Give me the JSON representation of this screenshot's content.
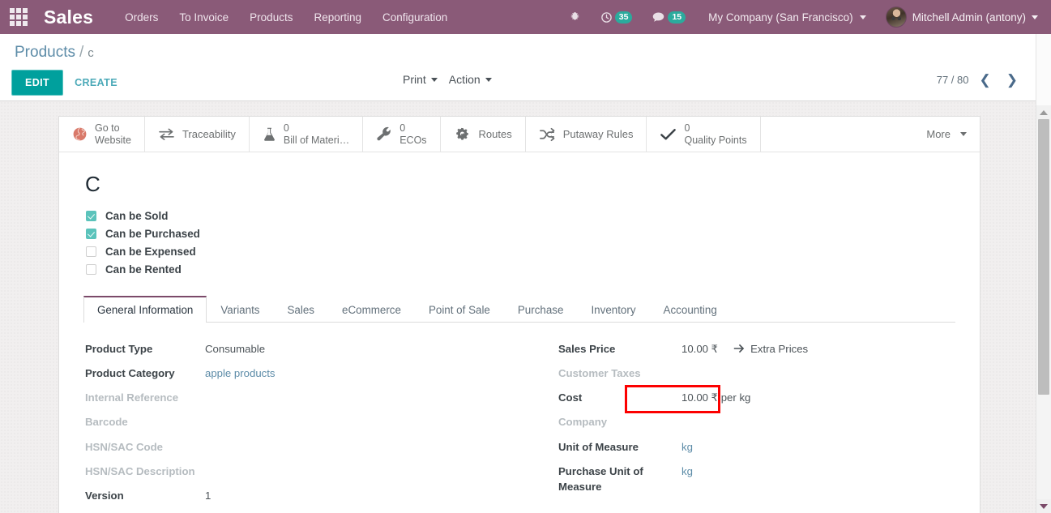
{
  "topbar": {
    "apps_icon": "apps-grid-icon",
    "brand": "Sales",
    "menu": [
      {
        "label": "Orders"
      },
      {
        "label": "To Invoice"
      },
      {
        "label": "Products"
      },
      {
        "label": "Reporting"
      },
      {
        "label": "Configuration"
      }
    ],
    "bug_icon": "bug-icon",
    "activities": {
      "icon": "clock-icon",
      "count": "35"
    },
    "messages": {
      "icon": "chat-bubble-icon",
      "count": "15"
    },
    "company": "My Company (San Francisco)",
    "user": "Mitchell Admin (antony)",
    "accent": "#8a5a78"
  },
  "control_panel": {
    "breadcrumb_root": "Products",
    "breadcrumb_separator": "/",
    "breadcrumb_current": "c",
    "edit_label": "EDIT",
    "create_label": "CREATE",
    "print_label": "Print",
    "action_label": "Action",
    "pager_text": "77 / 80",
    "prev_icon": "chevron-left-icon",
    "next_icon": "chevron-right-icon"
  },
  "button_box": [
    {
      "icon": "globe-icon",
      "value": "",
      "label": "Go to",
      "label2": "Website",
      "multiline": true
    },
    {
      "icon": "exchange-icon",
      "value": "",
      "label": "Traceability",
      "multiline": false
    },
    {
      "icon": "flask-icon",
      "value": "0",
      "label": "Bill of Materi…",
      "multiline": true
    },
    {
      "icon": "wrench-icon",
      "value": "0",
      "label": "ECOs",
      "multiline": true
    },
    {
      "icon": "cogs-icon",
      "value": "",
      "label": "Routes",
      "multiline": false
    },
    {
      "icon": "shuffle-icon",
      "value": "",
      "label": "Putaway Rules",
      "multiline": false
    },
    {
      "icon": "check-icon",
      "value": "0",
      "label": "Quality Points",
      "multiline": true
    },
    {
      "icon": "chevron-down-icon",
      "value": "",
      "label": "More",
      "multiline": false
    }
  ],
  "product": {
    "title": "C",
    "checkboxes": [
      {
        "label": "Can be Sold",
        "checked": true
      },
      {
        "label": "Can be Purchased",
        "checked": true
      },
      {
        "label": "Can be Expensed",
        "checked": false
      },
      {
        "label": "Can be Rented",
        "checked": false
      }
    ]
  },
  "tabs": [
    {
      "label": "General Information",
      "active": true
    },
    {
      "label": "Variants",
      "active": false
    },
    {
      "label": "Sales",
      "active": false
    },
    {
      "label": "eCommerce",
      "active": false
    },
    {
      "label": "Point of Sale",
      "active": false
    },
    {
      "label": "Purchase",
      "active": false
    },
    {
      "label": "Inventory",
      "active": false
    },
    {
      "label": "Accounting",
      "active": false
    }
  ],
  "form": {
    "left": [
      {
        "label": "Product Type",
        "value": "Consumable",
        "muted": false,
        "link": false
      },
      {
        "label": "Product Category",
        "value": "apple products",
        "muted": false,
        "link": true
      },
      {
        "label": "Internal Reference",
        "value": "",
        "muted": true,
        "link": false
      },
      {
        "label": "Barcode",
        "value": "",
        "muted": true,
        "link": false
      },
      {
        "label": "HSN/SAC Code",
        "value": "",
        "muted": true,
        "link": false
      },
      {
        "label": "HSN/SAC Description",
        "value": "",
        "muted": true,
        "link": false
      },
      {
        "label": "Version",
        "value": "1",
        "muted": false,
        "link": false
      }
    ],
    "right": {
      "sales_price": {
        "label": "Sales Price",
        "value": "10.00 ₹",
        "extra_icon": "arrow-right-icon",
        "extra_label": "Extra Prices"
      },
      "customer_taxes": {
        "label": "Customer Taxes",
        "value": ""
      },
      "cost": {
        "label": "Cost",
        "value": "10.00 ₹  per kg"
      },
      "company": {
        "label": "Company",
        "value": ""
      },
      "uom": {
        "label": "Unit of Measure",
        "value": "kg"
      },
      "purchase_uom": {
        "label": "Purchase Unit of Measure",
        "value": "kg"
      }
    }
  },
  "annotation": {
    "highlight_color": "#fc0000",
    "highlight_target": "cost-field-value"
  },
  "scrollbar": {
    "up_icon": "scroll-up-arrow-icon",
    "down_icon": "scroll-down-arrow-icon"
  }
}
